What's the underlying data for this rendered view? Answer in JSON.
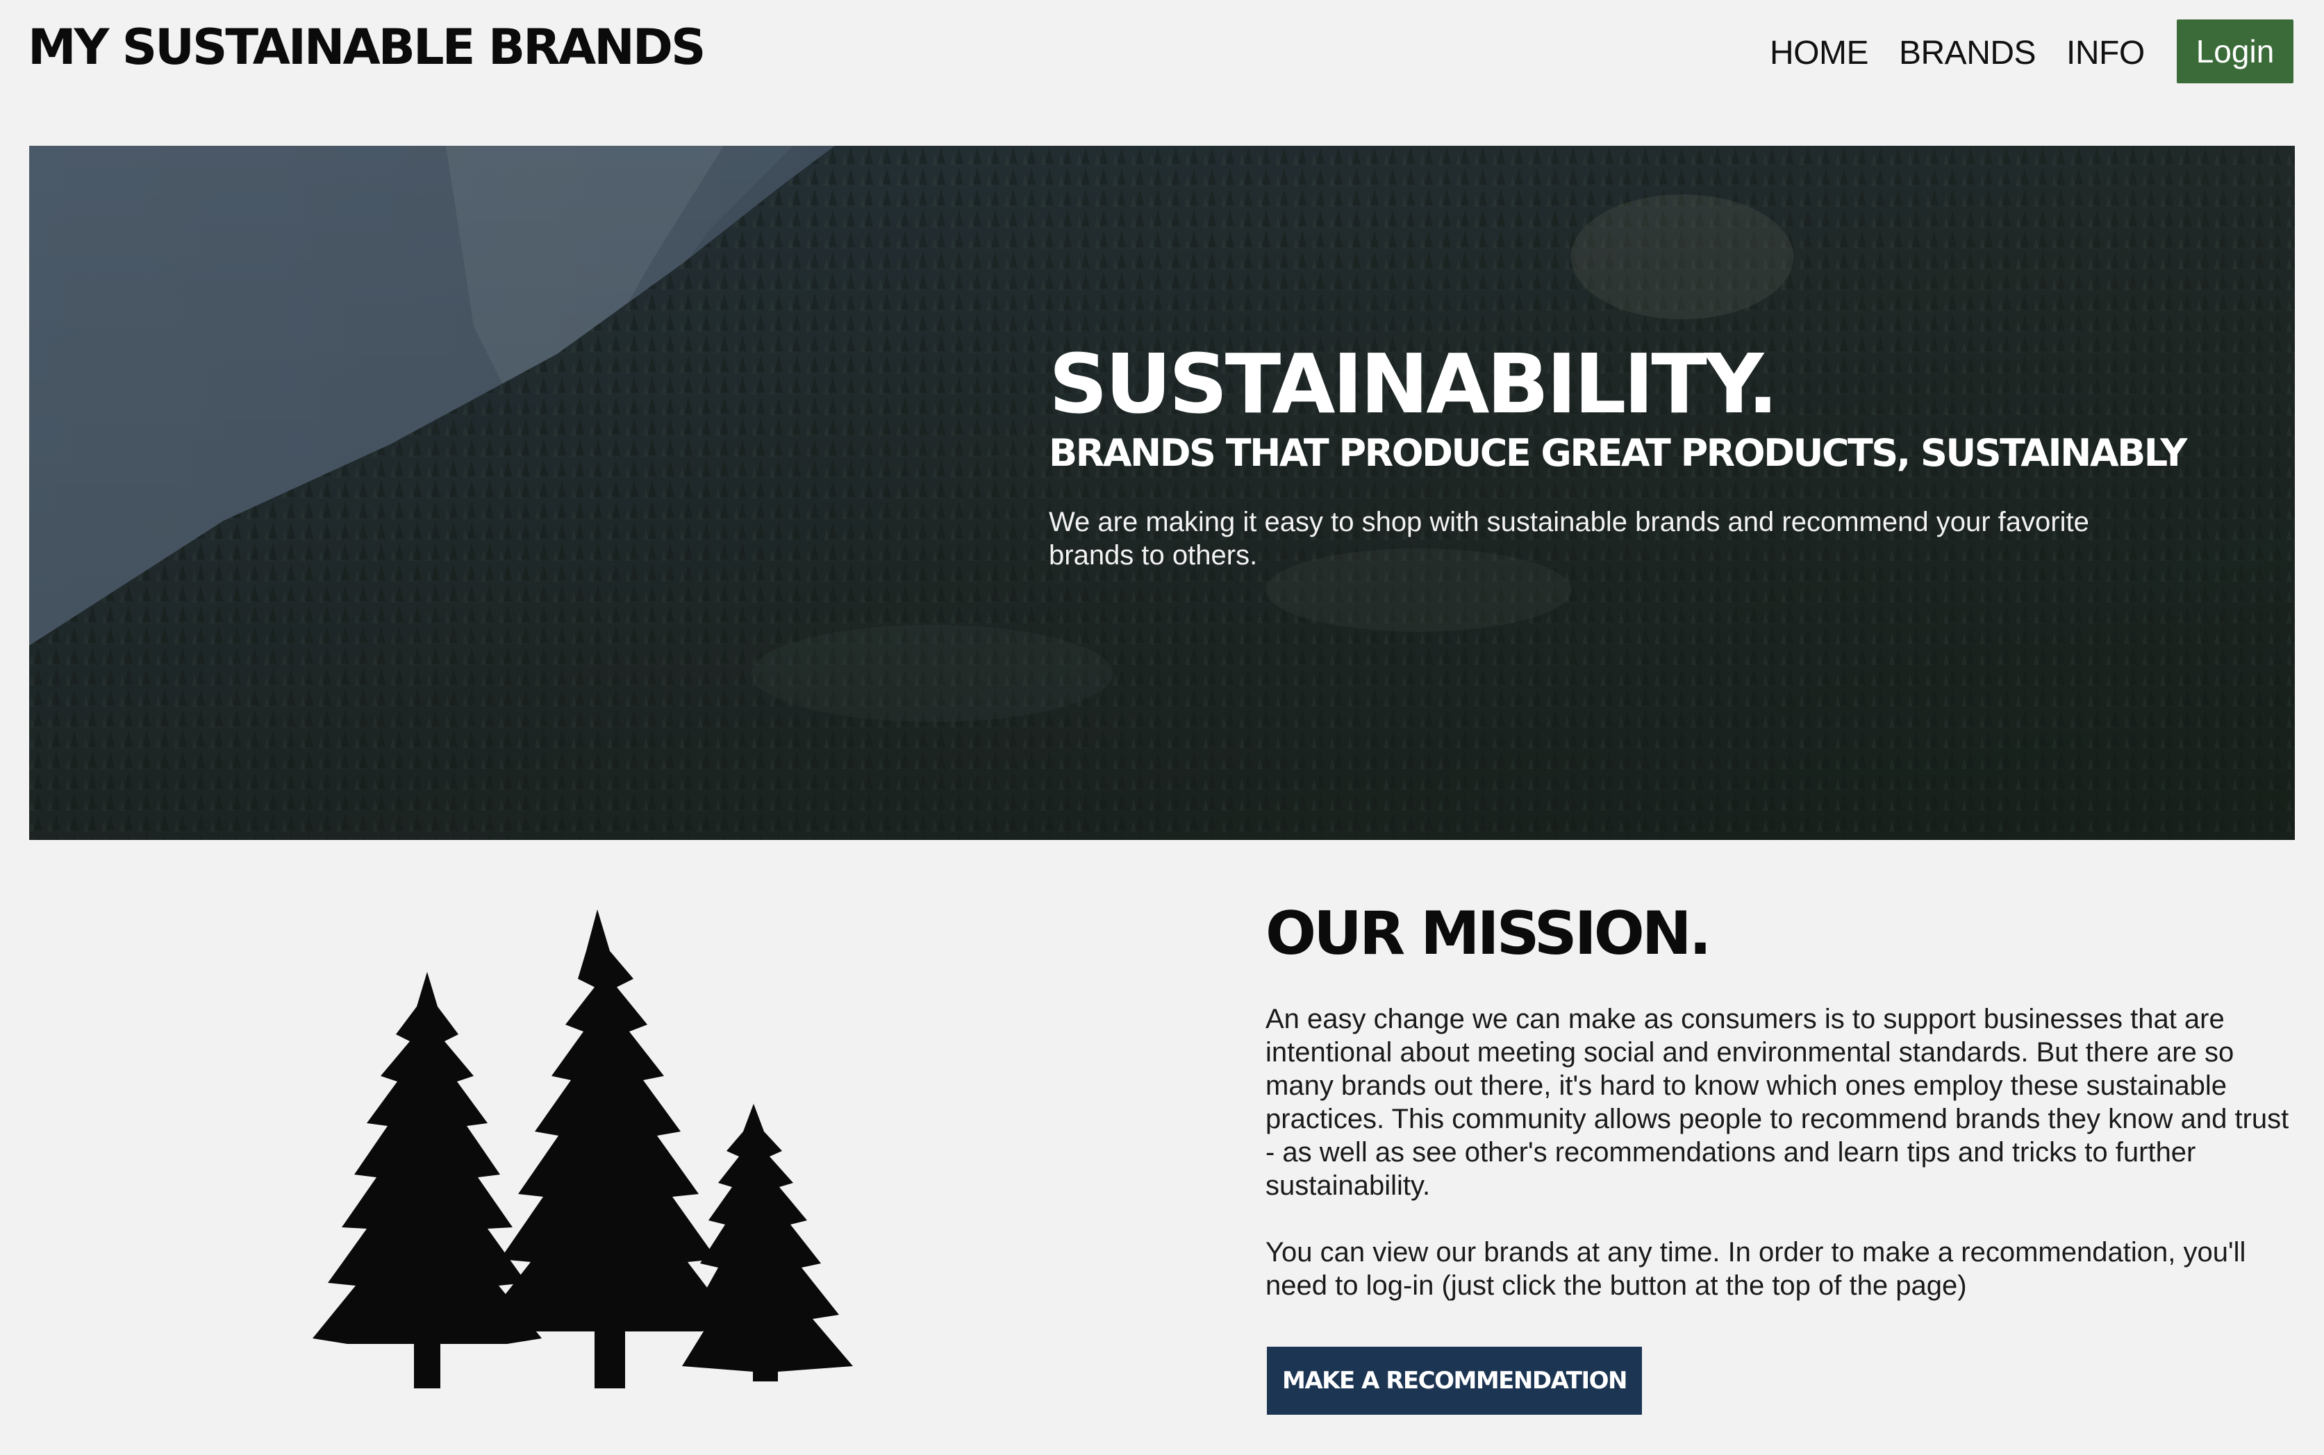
{
  "header": {
    "logo": "MY SUSTAINABLE BRANDS",
    "nav": [
      {
        "label": "HOME"
      },
      {
        "label": "BRANDS"
      },
      {
        "label": "INFO"
      }
    ],
    "login_label": "Login"
  },
  "hero": {
    "title": "SUSTAINABILITY.",
    "subtitle": "BRANDS THAT PRODUCE GREAT PRODUCTS, SUSTAINABLY",
    "body": "We are making it easy to shop with sustainable brands and recommend your favorite brands to others."
  },
  "mission": {
    "title": "OUR MISSION.",
    "paragraph1": "An easy change we can make as consumers is to support businesses that are intentional about meeting social and environmental standards. But there are so many brands out there, it's hard to know which ones employ these sustainable practices. This community allows people to recommend brands they know and trust - as well as see other's recommendations and learn tips and tricks to further sustainability.",
    "paragraph2": "You can view our brands at any time. In order to make a recommendation, you'll need to log-in (just click the button at the top of the page)",
    "button_label": "MAKE A RECOMMENDATION"
  },
  "colors": {
    "background": "#f2f2f2",
    "login_button": "#3b6b39",
    "recommend_button": "#1c3553",
    "hero_overlay": "#29333a"
  },
  "icons": {
    "hero_background": "mountain-forest-image",
    "mission_illustration": "pine-trees-silhouette"
  }
}
